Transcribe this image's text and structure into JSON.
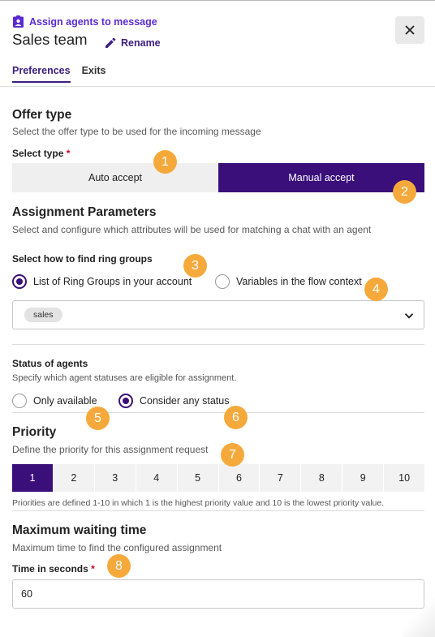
{
  "header": {
    "context_label": "Assign agents to message",
    "title": "Sales team",
    "rename_label": "Rename"
  },
  "tabs": [
    {
      "label": "Preferences",
      "active": true
    },
    {
      "label": "Exits",
      "active": false
    }
  ],
  "offer_type": {
    "heading": "Offer type",
    "description": "Select the offer type to be used for the incoming message",
    "select_label": "Select type",
    "required_mark": "*",
    "options": [
      {
        "label": "Auto accept",
        "selected": false
      },
      {
        "label": "Manual accept",
        "selected": true
      }
    ]
  },
  "assignment": {
    "heading": "Assignment Parameters",
    "description": "Select and configure which attributes will be used for matching a chat with an agent",
    "find_label": "Select how to find ring groups",
    "find_options": [
      {
        "label": "List of Ring Groups in your account",
        "selected": true
      },
      {
        "label": "Variables in the flow context",
        "selected": false
      }
    ],
    "selected_groups": [
      "sales"
    ]
  },
  "status": {
    "heading": "Status of agents",
    "description": "Specify which agent statuses are eligible for assignment.",
    "options": [
      {
        "label": "Only available",
        "selected": false
      },
      {
        "label": "Consider any status",
        "selected": true
      }
    ]
  },
  "priority": {
    "heading": "Priority",
    "description": "Define the priority for this assignment request",
    "values": [
      "1",
      "2",
      "3",
      "4",
      "5",
      "6",
      "7",
      "8",
      "9",
      "10"
    ],
    "selected": "1",
    "note": "Priorities are defined 1-10 in which 1 is the highest priority value and 10 is the lowest priority value."
  },
  "waiting": {
    "heading": "Maximum waiting time",
    "description": "Maximum time to find the configured assignment",
    "field_label": "Time in seconds",
    "required_mark": "*",
    "value": "60"
  },
  "markers": [
    "1",
    "2",
    "3",
    "4",
    "5",
    "6",
    "7",
    "8"
  ],
  "colors": {
    "accent": "#3a0f7a",
    "brand_purple": "#5b2bd1",
    "marker": "#f6a93b",
    "required": "#d0021b"
  },
  "icons": {
    "context": "badge-icon",
    "rename": "pencil-icon",
    "close": "close-icon",
    "select": "chevron-down-icon"
  }
}
